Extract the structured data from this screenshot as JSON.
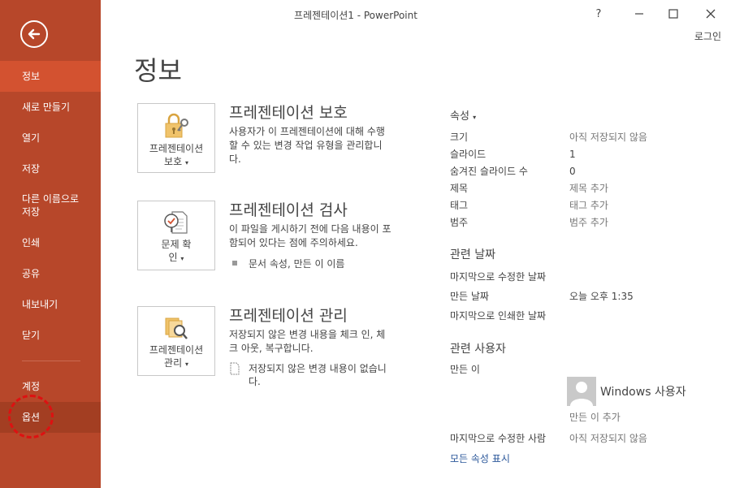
{
  "window": {
    "title": "프레젠테이션1 - PowerPoint",
    "help_label": "?",
    "login_label": "로그인"
  },
  "sidebar": {
    "accent": "#b7472a",
    "items": [
      {
        "label": "정보"
      },
      {
        "label": "새로 만들기"
      },
      {
        "label": "열기"
      },
      {
        "label": "저장"
      },
      {
        "label": "다른 이름으로 저장"
      },
      {
        "label": "인쇄"
      },
      {
        "label": "공유"
      },
      {
        "label": "내보내기"
      },
      {
        "label": "닫기"
      },
      {
        "label": "계정"
      },
      {
        "label": "옵션"
      }
    ]
  },
  "main": {
    "title": "정보",
    "protect": {
      "tile_label": "프레젠테이션 보호",
      "title": "프레젠테이션 보호",
      "desc": "사용자가 이 프레젠테이션에 대해 수행할 수 있는 변경 작업 유형을 관리합니다."
    },
    "inspect": {
      "tile_label": "문제 확인",
      "title": "프레젠테이션 검사",
      "desc": "이 파일을 게시하기 전에 다음 내용이 포함되어 있다는 점에 주의하세요.",
      "bullet": "문서 속성, 만든 이 이름"
    },
    "manage": {
      "tile_label": "프레젠테이션 관리",
      "title": "프레젠테이션 관리",
      "desc": "저장되지 않은 변경 내용을 체크 인, 체크 아웃, 복구합니다.",
      "bullet": "저장되지 않은 변경 내용이 없습니다."
    }
  },
  "properties": {
    "header": "속성",
    "rows": [
      {
        "label": "크기",
        "value": "아직 저장되지 않음"
      },
      {
        "label": "슬라이드",
        "value": "1"
      },
      {
        "label": "숨겨진 슬라이드 수",
        "value": "0"
      },
      {
        "label": "제목",
        "value": "제목 추가"
      },
      {
        "label": "태그",
        "value": "태그 추가"
      },
      {
        "label": "범주",
        "value": "범주 추가"
      }
    ],
    "dates_title": "관련 날짜",
    "dates": [
      {
        "label": "마지막으로 수정한 날짜",
        "value": ""
      },
      {
        "label": "만든 날짜",
        "value": "오늘 오후 1:35"
      },
      {
        "label": "마지막으로 인쇄한 날짜",
        "value": ""
      }
    ],
    "people_title": "관련 사용자",
    "author_label": "만든 이",
    "author_name": "Windows 사용자",
    "add_author": "만든 이 추가",
    "last_modified_by_label": "마지막으로 수정한 사람",
    "last_modified_by_value": "아직 저장되지 않음",
    "show_all": "모든 속성 표시"
  }
}
